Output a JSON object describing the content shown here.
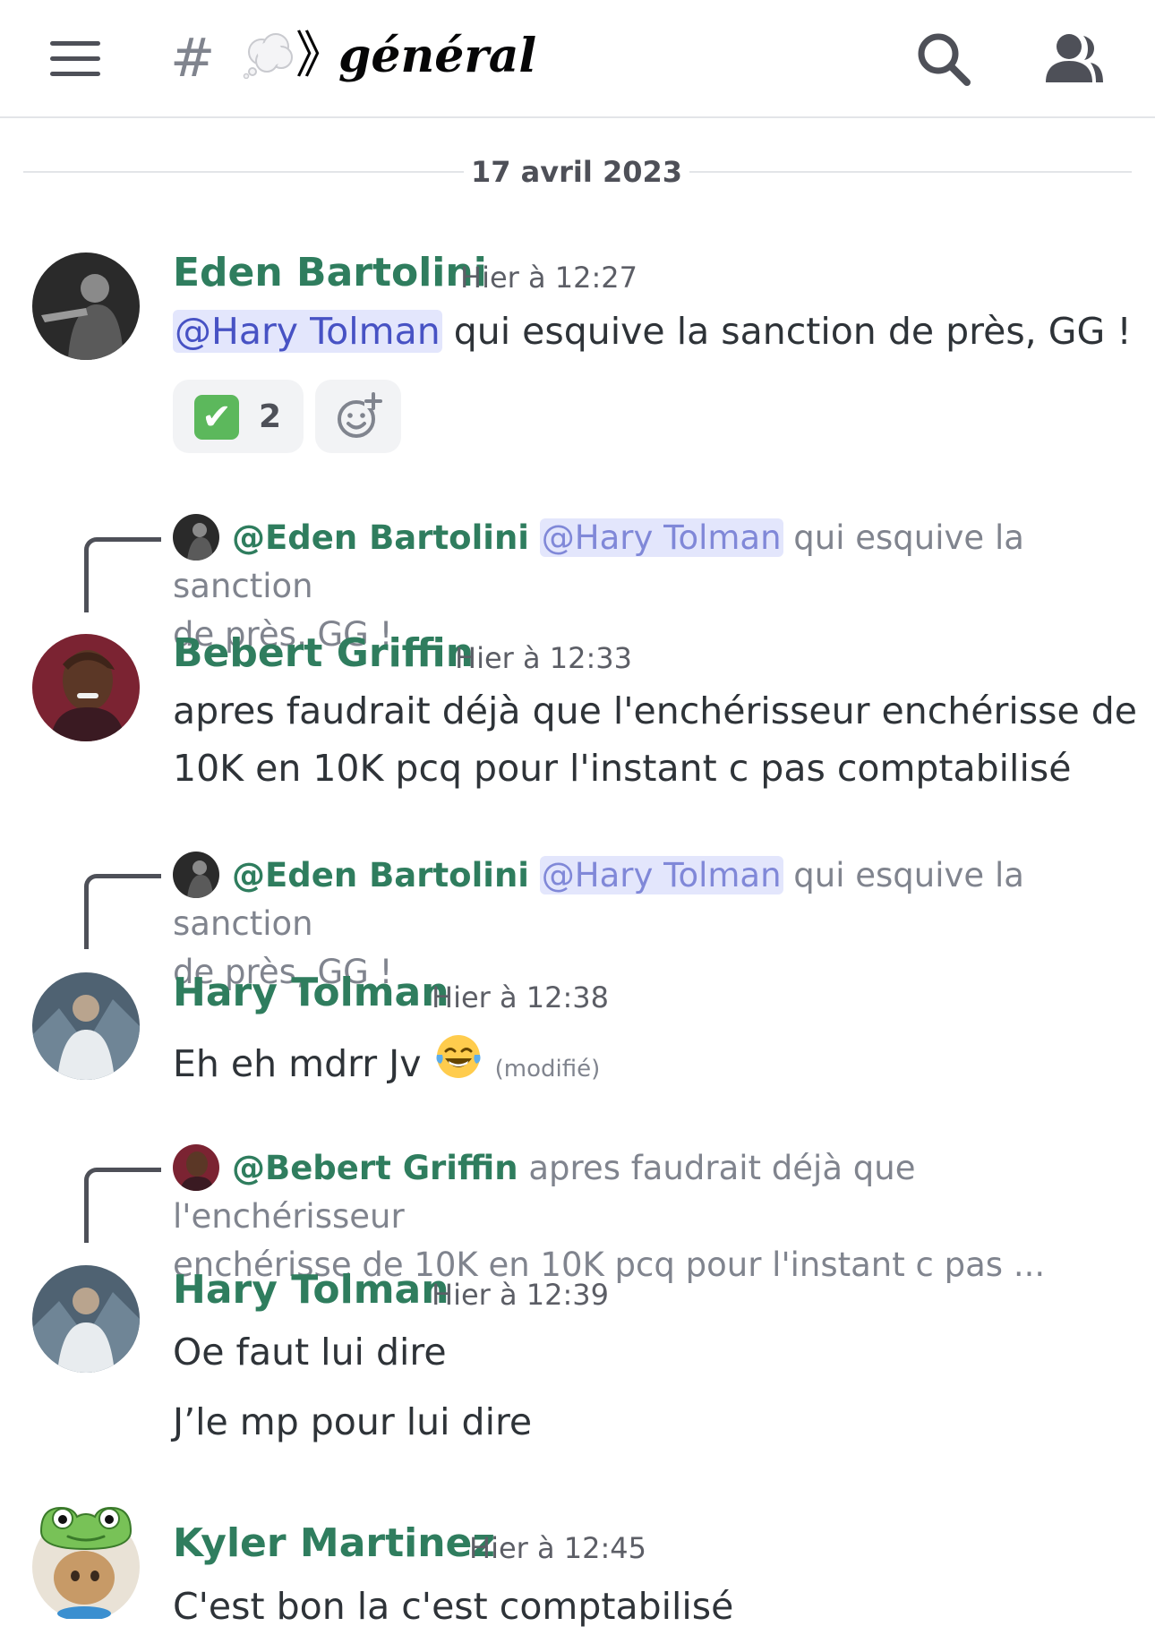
{
  "header": {
    "hash": "#",
    "separator": "》",
    "channel_name": "général",
    "icons": [
      "menu-icon",
      "hash-icon",
      "thought-cloud-icon",
      "search-icon",
      "members-icon"
    ]
  },
  "date_divider": "17 avril 2023",
  "messages": [
    {
      "author": "Eden Bartolini",
      "time": "Hier à 12:27",
      "mention": "@Hary Tolman",
      "text": " qui esquive la sanction de près, GG !",
      "reaction": {
        "emoji": "✔",
        "count": "2"
      }
    },
    {
      "reply": {
        "author": "@Eden Bartolini",
        "mention": "@Hary Tolman",
        "line1": " qui esquive la sanction",
        "line2": "de près, GG !"
      },
      "author": "Bebert Griffin",
      "time": "Hier à 12:33",
      "line1": "apres faudrait déjà que l'enchérisseur enchérisse de",
      "line2": "10K en 10K pcq pour l'instant c pas comptabilisé"
    },
    {
      "reply": {
        "author": "@Eden Bartolini",
        "mention": "@Hary Tolman",
        "line1": " qui esquive la sanction",
        "line2": "de près, GG !"
      },
      "author": "Hary Tolman",
      "time": "Hier à 12:38",
      "text": "Eh eh mdrr Jv ",
      "edited": "(modifié)"
    },
    {
      "reply": {
        "author": "@Bebert Griffin",
        "line1": " apres faudrait déjà que l'enchérisseur",
        "line2": "enchérisse de 10K en 10K pcq pour l'instant c pas ..."
      },
      "author": "Hary Tolman",
      "time": "Hier à 12:39",
      "line1": "Oe faut lui dire",
      "line2": "J’le mp pour lui dire"
    },
    {
      "author": "Kyler Martinez",
      "time": "Hier à 12:45",
      "text": "C'est bon la c'est comptabilisé"
    }
  ],
  "colors": {
    "author": "#2f7d5e",
    "mention_bg": "#e3e6fc",
    "mention_text": "#4752c4",
    "muted": "#80848e",
    "reaction_bg": "#f2f3f5"
  }
}
